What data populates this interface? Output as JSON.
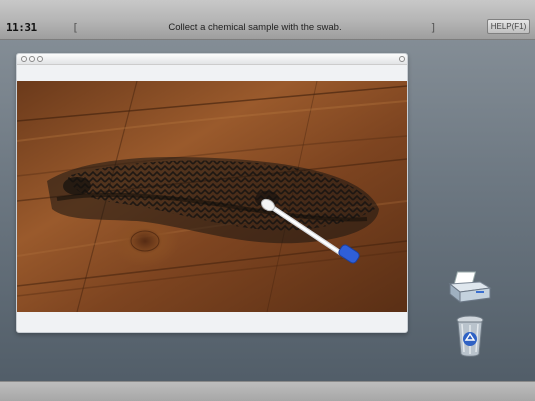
{
  "header": {
    "timer": "11:31",
    "instruction": "Collect a chemical sample with the swab.",
    "bracket_left": "[",
    "bracket_right": "]",
    "help_label": "HELP(F1)"
  },
  "scene": {
    "description_icon": "wood-floor-with-tire-track-stain",
    "tool": "swab-icon",
    "tool_tip_color": "#2f5fd8"
  },
  "dock": {
    "printer_icon": "printer-icon",
    "trash_icon": "recycle-bin-icon"
  }
}
